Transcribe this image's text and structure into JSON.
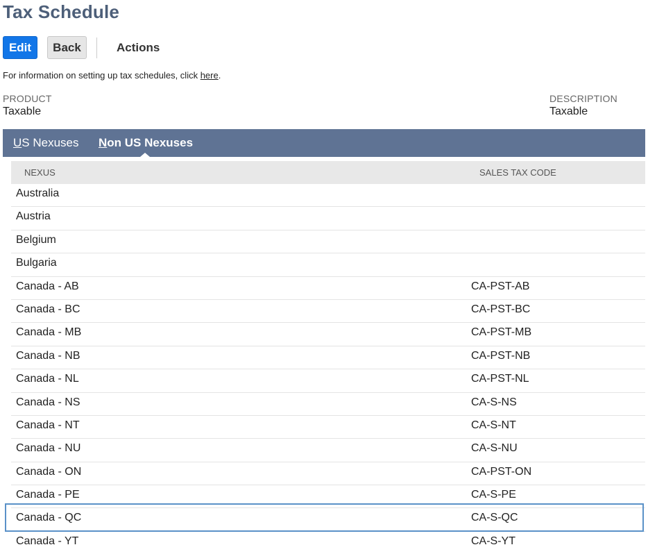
{
  "page": {
    "title": "Tax Schedule"
  },
  "toolbar": {
    "edit_label": "Edit",
    "back_label": "Back",
    "actions_label": "Actions"
  },
  "info": {
    "prefix": "For information on setting up tax schedules, click ",
    "link": "here",
    "suffix": "."
  },
  "fields": {
    "product_label": "PRODUCT",
    "product_value": "Taxable",
    "description_label": "DESCRIPTION",
    "description_value": "Taxable"
  },
  "tabs": [
    {
      "label_ul": "U",
      "label_rest": "S Nexuses",
      "active": false
    },
    {
      "label_ul": "N",
      "label_rest": "on US Nexuses",
      "active": true
    }
  ],
  "table": {
    "columns": [
      "NEXUS",
      "SALES TAX CODE"
    ],
    "rows": [
      {
        "nexus": "Australia",
        "code": ""
      },
      {
        "nexus": "Austria",
        "code": ""
      },
      {
        "nexus": "Belgium",
        "code": ""
      },
      {
        "nexus": "Bulgaria",
        "code": ""
      },
      {
        "nexus": "Canada - AB",
        "code": "CA-PST-AB"
      },
      {
        "nexus": "Canada - BC",
        "code": "CA-PST-BC"
      },
      {
        "nexus": "Canada - MB",
        "code": "CA-PST-MB"
      },
      {
        "nexus": "Canada - NB",
        "code": "CA-PST-NB"
      },
      {
        "nexus": "Canada - NL",
        "code": "CA-PST-NL"
      },
      {
        "nexus": "Canada - NS",
        "code": "CA-S-NS"
      },
      {
        "nexus": "Canada - NT",
        "code": "CA-S-NT"
      },
      {
        "nexus": "Canada - NU",
        "code": "CA-S-NU"
      },
      {
        "nexus": "Canada - ON",
        "code": "CA-PST-ON"
      },
      {
        "nexus": "Canada - PE",
        "code": "CA-S-PE"
      },
      {
        "nexus": "Canada - QC",
        "code": "CA-S-QC"
      },
      {
        "nexus": "Canada - YT",
        "code": "CA-S-YT"
      }
    ],
    "highlighted_nexus": "Canada - QC"
  },
  "colors": {
    "title": "#4d5f79",
    "primary_button": "#1276e8",
    "tabbar": "#5f7394",
    "highlight": "#5a91c8"
  }
}
